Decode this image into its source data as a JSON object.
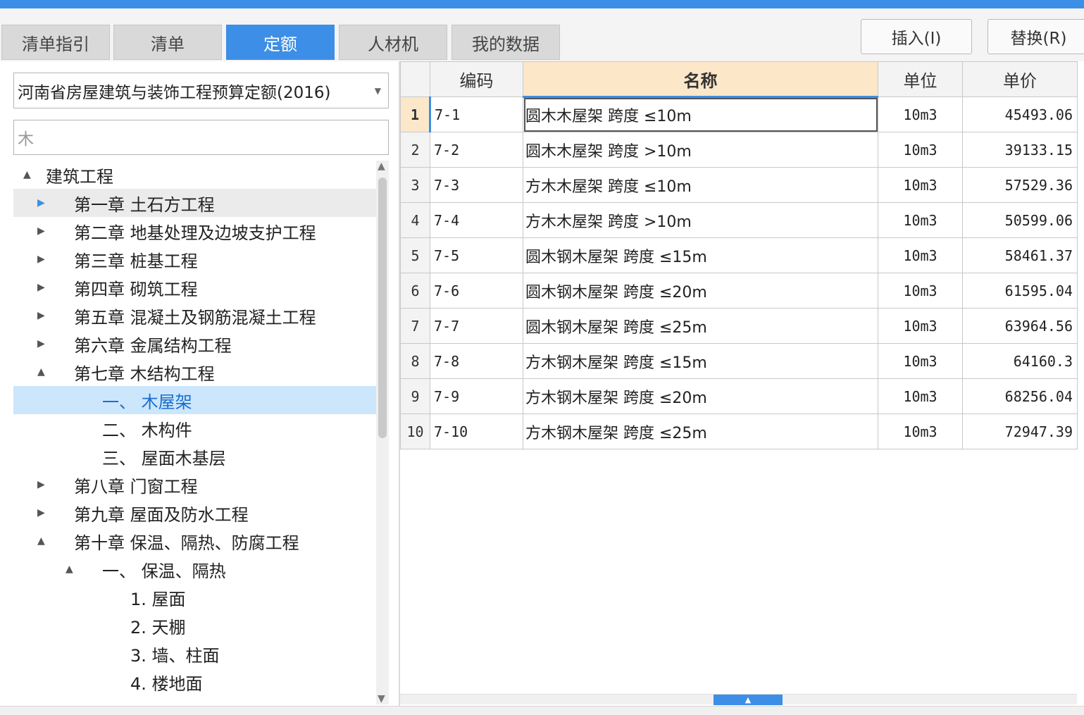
{
  "tabs": [
    {
      "label": "清单指引",
      "active": false
    },
    {
      "label": "清单",
      "active": false
    },
    {
      "label": "定额",
      "active": true
    },
    {
      "label": "人材机",
      "active": false
    },
    {
      "label": "我的数据",
      "active": false
    }
  ],
  "buttons": {
    "insert": "插入(I)",
    "replace": "替换(R)"
  },
  "library_select": {
    "value": "河南省房屋建筑与装饰工程预算定额(2016)",
    "caret_icon": "dropdown-caret-icon"
  },
  "search": {
    "value": "木"
  },
  "tree": [
    {
      "label": "建筑工程",
      "toggle": "▲",
      "state": "expanded",
      "level": 0
    },
    {
      "label": "第一章 土石方工程",
      "toggle": "▶",
      "state": "collapsed",
      "level": 1,
      "hover": true
    },
    {
      "label": "第二章 地基处理及边坡支护工程",
      "toggle": "▶",
      "state": "collapsed",
      "level": 1
    },
    {
      "label": "第三章 桩基工程",
      "toggle": "▶",
      "state": "collapsed",
      "level": 1
    },
    {
      "label": "第四章 砌筑工程",
      "toggle": "▶",
      "state": "collapsed",
      "level": 1
    },
    {
      "label": "第五章 混凝土及钢筋混凝土工程",
      "toggle": "▶",
      "state": "collapsed",
      "level": 1
    },
    {
      "label": "第六章 金属结构工程",
      "toggle": "▶",
      "state": "collapsed",
      "level": 1
    },
    {
      "label": "第七章 木结构工程",
      "toggle": "▲",
      "state": "expanded",
      "level": 1
    },
    {
      "label": "一、 木屋架",
      "toggle": "",
      "state": "leaf",
      "level": 2,
      "selected": true
    },
    {
      "label": "二、 木构件",
      "toggle": "",
      "state": "leaf",
      "level": 2
    },
    {
      "label": "三、 屋面木基层",
      "toggle": "",
      "state": "leaf",
      "level": 2
    },
    {
      "label": "第八章 门窗工程",
      "toggle": "▶",
      "state": "collapsed",
      "level": 1
    },
    {
      "label": "第九章 屋面及防水工程",
      "toggle": "▶",
      "state": "collapsed",
      "level": 1
    },
    {
      "label": "第十章 保温、隔热、防腐工程",
      "toggle": "▲",
      "state": "expanded",
      "level": 1
    },
    {
      "label": "一、 保温、隔热",
      "toggle": "▲",
      "state": "expanded",
      "level": 2
    },
    {
      "label": "1. 屋面",
      "toggle": "",
      "state": "leaf",
      "level": 3
    },
    {
      "label": "2. 天棚",
      "toggle": "",
      "state": "leaf",
      "level": 3
    },
    {
      "label": "3. 墙、柱面",
      "toggle": "",
      "state": "leaf",
      "level": 3
    },
    {
      "label": "4. 楼地面",
      "toggle": "",
      "state": "leaf",
      "level": 3
    }
  ],
  "grid": {
    "columns": {
      "code": "编码",
      "name": "名称",
      "unit": "单位",
      "price": "单价"
    },
    "rows": [
      {
        "no": "1",
        "code": "7-1",
        "name": "圆木木屋架 跨度 ≤10m",
        "unit": "10m3",
        "price": "45493.06"
      },
      {
        "no": "2",
        "code": "7-2",
        "name": "圆木木屋架 跨度 >10m",
        "unit": "10m3",
        "price": "39133.15"
      },
      {
        "no": "3",
        "code": "7-3",
        "name": "方木木屋架 跨度 ≤10m",
        "unit": "10m3",
        "price": "57529.36"
      },
      {
        "no": "4",
        "code": "7-4",
        "name": "方木木屋架 跨度 >10m",
        "unit": "10m3",
        "price": "50599.06"
      },
      {
        "no": "5",
        "code": "7-5",
        "name": "圆木钢木屋架 跨度 ≤15m",
        "unit": "10m3",
        "price": "58461.37"
      },
      {
        "no": "6",
        "code": "7-6",
        "name": "圆木钢木屋架 跨度 ≤20m",
        "unit": "10m3",
        "price": "61595.04"
      },
      {
        "no": "7",
        "code": "7-7",
        "name": "圆木钢木屋架 跨度 ≤25m",
        "unit": "10m3",
        "price": "63964.56"
      },
      {
        "no": "8",
        "code": "7-8",
        "name": "方木钢木屋架 跨度 ≤15m",
        "unit": "10m3",
        "price": "64160.3"
      },
      {
        "no": "9",
        "code": "7-9",
        "name": "方木钢木屋架 跨度 ≤20m",
        "unit": "10m3",
        "price": "68256.04"
      },
      {
        "no": "10",
        "code": "7-10",
        "name": "方木钢木屋架 跨度 ≤25m",
        "unit": "10m3",
        "price": "72947.39"
      }
    ]
  },
  "colors": {
    "accent": "#3d8ee6",
    "selected_row": "#cce6fb",
    "current_header": "#fde7c9"
  }
}
